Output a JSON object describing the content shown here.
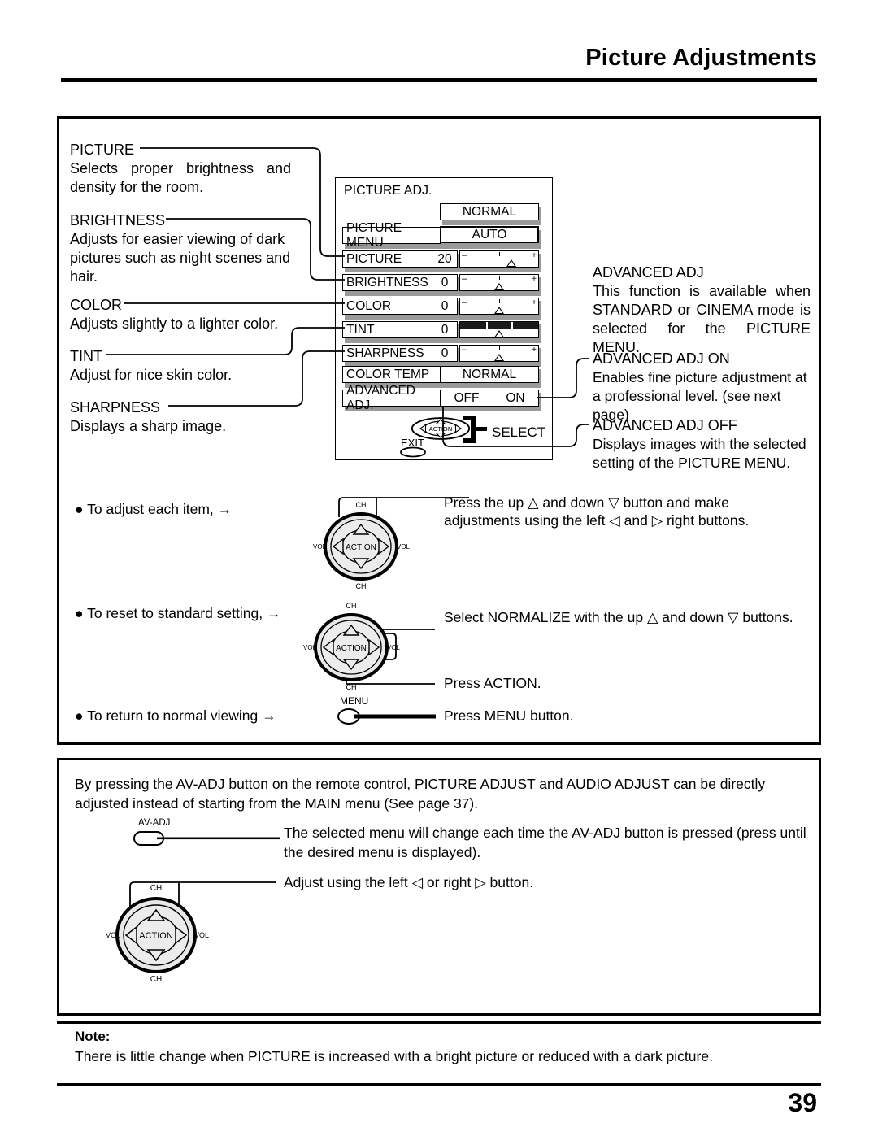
{
  "header": {
    "title": "Picture Adjustments"
  },
  "left_column": [
    {
      "label": "PICTURE",
      "desc": "Selects proper brightness and density for the room."
    },
    {
      "label": "BRIGHTNESS",
      "desc": "Adjusts for easier viewing of dark pictures such as night scenes and hair."
    },
    {
      "label": "COLOR",
      "desc": "Adjusts slightly to a lighter color."
    },
    {
      "label": "TINT",
      "desc": "Adjust for nice skin color."
    },
    {
      "label": "SHARPNESS",
      "desc": "Displays a sharp image."
    }
  ],
  "right_column": [
    {
      "label": "ADVANCED ADJ",
      "desc": "This function is available when STANDARD or CINEMA mode is selected for the PICTURE MENU."
    },
    {
      "label": "ADVANCED ADJ ON",
      "desc": "Enables fine picture adjustment at a professional level. (see next page)"
    },
    {
      "label": "ADVANCED ADJ OFF",
      "desc": "Displays images with the selected setting of the PICTURE MENU."
    }
  ],
  "osd": {
    "title": "PICTURE ADJ.",
    "normal_button": "NORMAL",
    "picture_menu": {
      "label": "PICTURE  MENU",
      "value": "AUTO"
    },
    "sliders": [
      {
        "label": "PICTURE",
        "value": "20",
        "minus": "–",
        "plus": "+",
        "pos": 66
      },
      {
        "label": "BRIGHTNESS",
        "value": "0",
        "minus": "–",
        "plus": "+",
        "pos": 50
      },
      {
        "label": "COLOR",
        "value": "0",
        "minus": "–",
        "plus": "+",
        "pos": 50
      },
      {
        "label": "TINT",
        "value": "0",
        "minus": "",
        "plus": "",
        "pos": 50
      },
      {
        "label": "SHARPNESS",
        "value": "0",
        "minus": "–",
        "plus": "+",
        "pos": 50
      }
    ],
    "color_temp": {
      "label": "COLOR  TEMP",
      "value": "NORMAL"
    },
    "advanced_adj": {
      "label": "ADVANCED ADJ.",
      "off": "OFF",
      "on": "ON"
    },
    "action_label": "ACTION",
    "select_label": "SELECT",
    "exit_label": "EXIT"
  },
  "steps": [
    {
      "bullet": "●",
      "text": "To adjust each item,",
      "arrow": "→",
      "instruction": "Press the up △ and down ▽ button and make adjustments using the left ◁ and ▷ right  buttons."
    },
    {
      "bullet": "●",
      "text": "To reset to standard setting,",
      "arrow": "→",
      "instruction": "Select NORMALIZE with the up △ and down ▽ buttons.",
      "instruction2": "Press ACTION."
    },
    {
      "bullet": "●",
      "text": "To return to  normal viewing",
      "arrow": "→",
      "instruction": "Press MENU button."
    }
  ],
  "pad": {
    "action": "ACTION",
    "ch": "CH",
    "vol": "VOL"
  },
  "menu_button": {
    "label": "MENU"
  },
  "bottom": {
    "intro": "By pressing the AV-ADJ button on the remote control, PICTURE ADJUST and AUDIO ADJUST can be directly adjusted instead of starting from the MAIN menu (See page 37).",
    "avadj_label": "AV-ADJ",
    "line1": "The selected menu will change each time the AV-ADJ button is pressed (press until the desired menu is displayed).",
    "line2": "Adjust using the left ◁ or right ▷ button."
  },
  "note": {
    "label": "Note:",
    "text": "There is little change when PICTURE is increased with a bright picture or reduced with a dark picture."
  },
  "page_number": "39"
}
